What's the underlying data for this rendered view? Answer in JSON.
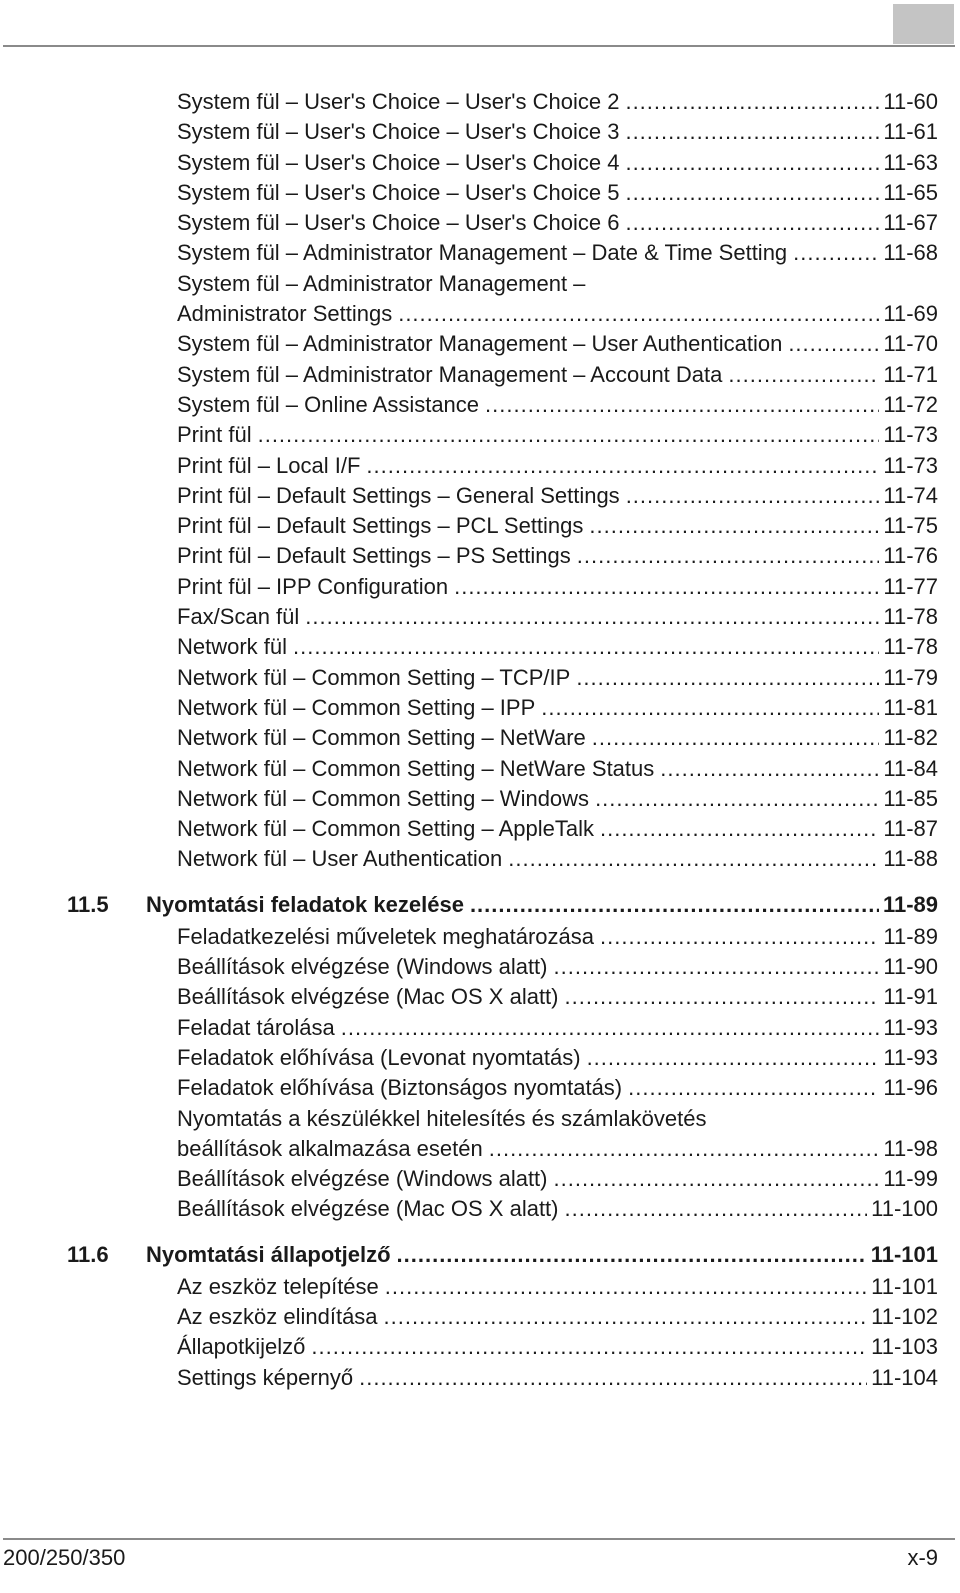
{
  "toc": [
    {
      "title": "System fül – User's Choice – User's Choice 2",
      "page": "11-60"
    },
    {
      "title": "System fül – User's Choice – User's Choice 3",
      "page": "11-61"
    },
    {
      "title": "System fül – User's Choice – User's Choice 4",
      "page": "11-63"
    },
    {
      "title": "System fül – User's Choice – User's Choice 5",
      "page": "11-65"
    },
    {
      "title": "System fül – User's Choice – User's Choice 6",
      "page": "11-67"
    },
    {
      "title": "System fül – Administrator Management – Date & Time Setting",
      "page": "11-68"
    },
    {
      "title_first": "System fül – Administrator Management –",
      "title": "Administrator Settings",
      "page": "11-69"
    },
    {
      "title": "System fül – Administrator Management – User Authentication",
      "page": "11-70"
    },
    {
      "title": "System fül – Administrator Management – Account Data",
      "page": "11-71"
    },
    {
      "title": "System fül – Online Assistance",
      "page": "11-72"
    },
    {
      "title": "Print fül",
      "page": "11-73"
    },
    {
      "title": "Print fül – Local I/F",
      "page": "11-73"
    },
    {
      "title": "Print fül – Default Settings – General Settings",
      "page": "11-74"
    },
    {
      "title": "Print fül – Default Settings – PCL Settings",
      "page": "11-75"
    },
    {
      "title": "Print fül – Default Settings – PS Settings",
      "page": "11-76"
    },
    {
      "title": "Print fül – IPP Configuration",
      "page": "11-77"
    },
    {
      "title": "Fax/Scan fül",
      "page": "11-78"
    },
    {
      "title": "Network fül",
      "page": "11-78"
    },
    {
      "title": "Network fül – Common Setting – TCP/IP",
      "page": "11-79"
    },
    {
      "title": "Network fül – Common Setting – IPP",
      "page": "11-81"
    },
    {
      "title": "Network fül – Common Setting – NetWare",
      "page": "11-82"
    },
    {
      "title": "Network fül – Common Setting – NetWare Status",
      "page": "11-84"
    },
    {
      "title": "Network fül – Common Setting – Windows",
      "page": "11-85"
    },
    {
      "title": "Network fül – Common Setting – AppleTalk",
      "page": "11-87"
    },
    {
      "title": "Network fül – User Authentication",
      "page": "11-88"
    },
    {
      "section": "11.5",
      "title": "Nyomtatási feladatok kezelése",
      "page": "11-89"
    },
    {
      "title": "Feladatkezelési műveletek meghatározása",
      "page": "11-89"
    },
    {
      "title": "Beállítások elvégzése (Windows alatt)",
      "page": "11-90"
    },
    {
      "title": "Beállítások elvégzése (Mac OS X alatt)",
      "page": "11-91"
    },
    {
      "title": "Feladat tárolása",
      "page": "11-93"
    },
    {
      "title": "Feladatok előhívása (Levonat nyomtatás)",
      "page": "11-93"
    },
    {
      "title": "Feladatok előhívása (Biztonságos nyomtatás)",
      "page": "11-96"
    },
    {
      "title_first": "Nyomtatás a készülékkel hitelesítés és számlakövetés",
      "title": "beállítások alkalmazása esetén",
      "page": "11-98"
    },
    {
      "title": "Beállítások elvégzése (Windows alatt)",
      "page": "11-99"
    },
    {
      "title": "Beállítások elvégzése (Mac OS X alatt)",
      "page": "11-100"
    },
    {
      "section": "11.6",
      "title": "Nyomtatási állapotjelző",
      "page": "11-101"
    },
    {
      "title": "Az eszköz telepítése",
      "page": "11-101"
    },
    {
      "title": "Az eszköz elindítása",
      "page": "11-102"
    },
    {
      "title": "Állapotkijelző",
      "page": "11-103"
    },
    {
      "title": "Settings képernyő",
      "page": "11-104"
    }
  ],
  "footer": {
    "model": "200/250/350",
    "page_number": "x-9"
  },
  "colors": {
    "text": "#1a1a1a",
    "rule": "#8a8a8a",
    "tab_marker": "#c4c4c4"
  }
}
